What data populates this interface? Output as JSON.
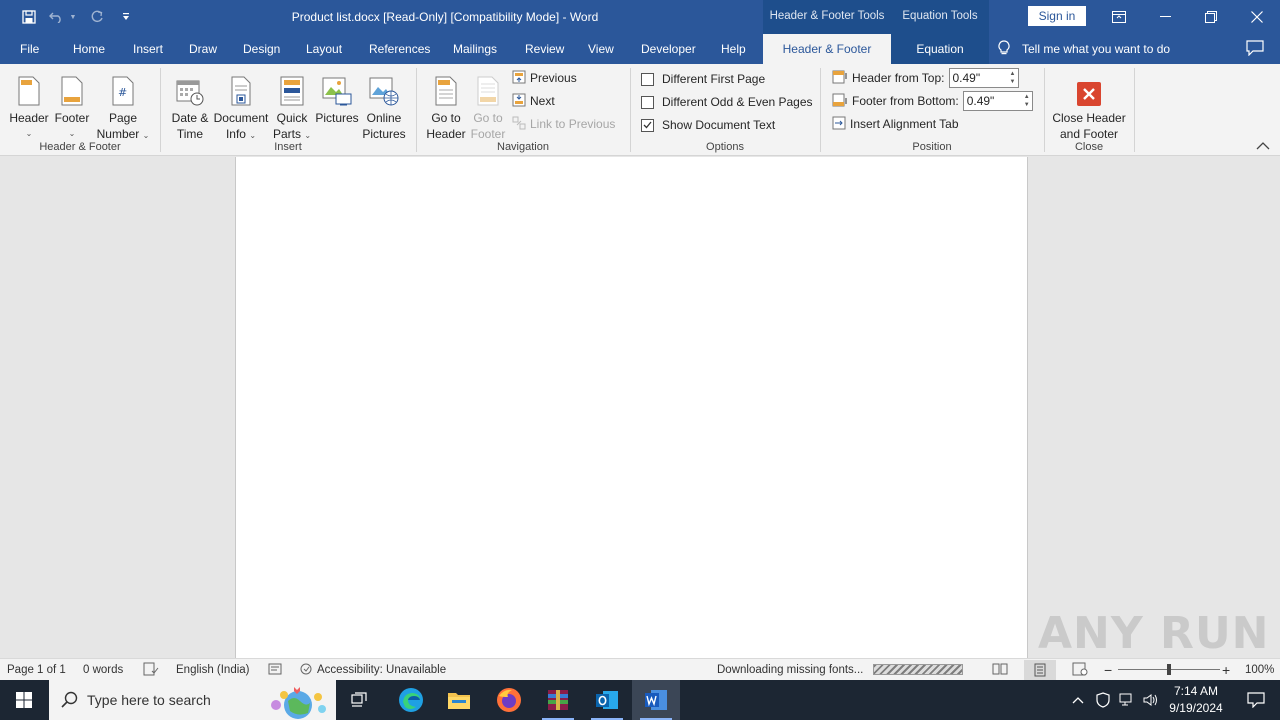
{
  "titlebar": {
    "title": "Product list.docx [Read-Only] [Compatibility Mode]  -  Word",
    "context_tabs": [
      "Header & Footer Tools",
      "Equation Tools"
    ],
    "sign_in": "Sign in"
  },
  "tabs": [
    "File",
    "Home",
    "Insert",
    "Draw",
    "Design",
    "Layout",
    "References",
    "Mailings",
    "Review",
    "View",
    "Developer",
    "Help",
    "Header & Footer",
    "Equation"
  ],
  "active_tab": "Header & Footer",
  "tell_me": "Tell me what you want to do",
  "ribbon": {
    "header_footer": {
      "header": "Header",
      "footer": "Footer",
      "page_number_1": "Page",
      "page_number_2": "Number",
      "group": "Header & Footer"
    },
    "insert": {
      "date_time_1": "Date &",
      "date_time_2": "Time",
      "doc_info_1": "Document",
      "doc_info_2": "Info",
      "quick_parts_1": "Quick",
      "quick_parts_2": "Parts",
      "pictures": "Pictures",
      "online_pictures_1": "Online",
      "online_pictures_2": "Pictures",
      "group": "Insert"
    },
    "navigation": {
      "go_header_1": "Go to",
      "go_header_2": "Header",
      "go_footer_1": "Go to",
      "go_footer_2": "Footer",
      "previous": "Previous",
      "next": "Next",
      "link_previous": "Link to Previous",
      "group": "Navigation"
    },
    "options": {
      "diff_first": "Different First Page",
      "diff_odd_even": "Different Odd & Even Pages",
      "show_doc_text": "Show Document Text",
      "diff_first_checked": false,
      "diff_odd_even_checked": false,
      "show_doc_text_checked": true,
      "group": "Options"
    },
    "position": {
      "header_top_label": "Header from Top:",
      "header_top_value": "0.49\"",
      "footer_bottom_label": "Footer from Bottom:",
      "footer_bottom_value": "0.49\"",
      "align_tab": "Insert Alignment Tab",
      "group": "Position"
    },
    "close": {
      "close_1": "Close Header",
      "close_2": "and Footer",
      "group": "Close"
    }
  },
  "statusbar": {
    "page": "Page 1 of 1",
    "words": "0 words",
    "language": "English (India)",
    "accessibility": "Accessibility: Unavailable",
    "downloading": "Downloading missing fonts...",
    "zoom": "100%"
  },
  "watermark": "ANY RUN",
  "taskbar": {
    "search_placeholder": "Type here to search",
    "time": "7:14 AM",
    "date": "9/19/2024"
  },
  "colors": {
    "word_blue": "#2b579a",
    "ribbon_bg": "#f3f3f3",
    "close_red": "#d9452f"
  }
}
